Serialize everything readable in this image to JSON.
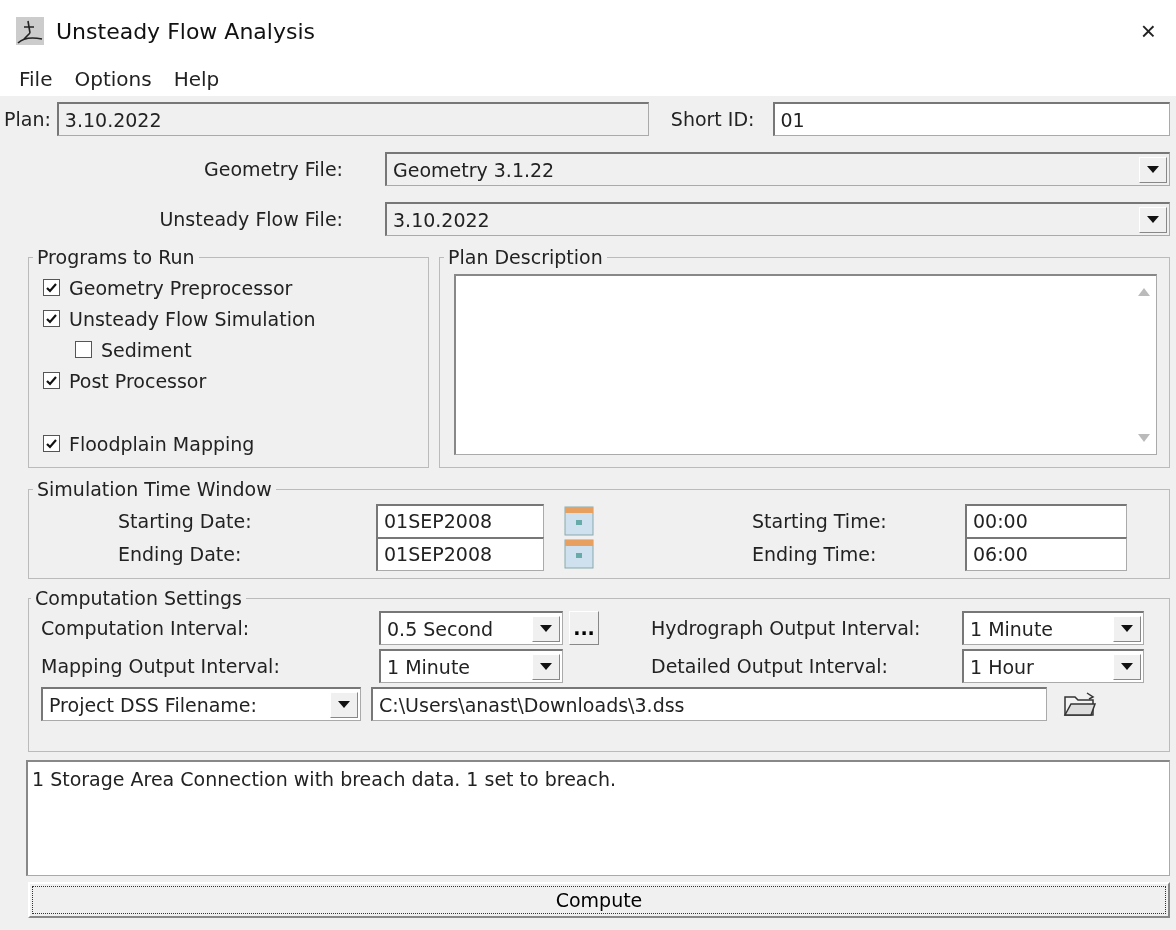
{
  "window": {
    "title": "Unsteady Flow Analysis",
    "close": "×"
  },
  "menu": [
    "File",
    "Options",
    "Help"
  ],
  "plan": {
    "label": "Plan:",
    "value": "3.10.2022"
  },
  "short_id": {
    "label": "Short ID:",
    "value": "01"
  },
  "file_selectors": [
    {
      "label": "Geometry File:",
      "value": "Geometry 3.1.22"
    },
    {
      "label": "Unsteady Flow File:",
      "value": "3.10.2022"
    }
  ],
  "programs_to_run": {
    "title": "Programs to Run",
    "items": [
      {
        "label": "Geometry Preprocessor",
        "checked": true
      },
      {
        "label": "Unsteady Flow Simulation",
        "checked": true,
        "children": [
          {
            "label": "Sediment",
            "checked": false
          }
        ]
      },
      {
        "label": "Post Processor",
        "checked": true
      },
      {
        "label": "Floodplain Mapping",
        "checked": true
      }
    ]
  },
  "plan_description": {
    "title": "Plan Description"
  },
  "simulation_time_window": {
    "title": "Simulation Time Window",
    "rows": [
      {
        "date_label": "Starting Date:",
        "date": "01SEP2008",
        "time_label": "Starting Time:",
        "time": "00:00"
      },
      {
        "date_label": "Ending Date:",
        "date": "01SEP2008",
        "time_label": "Ending Time:",
        "time": "06:00"
      }
    ]
  },
  "computation_settings": {
    "title": "Computation Settings",
    "more_button": "...",
    "intervals": [
      {
        "label": "Computation Interval:",
        "value": "0.5 Second"
      },
      {
        "label": "Hydrograph Output Interval:",
        "value": "1 Minute"
      },
      {
        "label": "Mapping Output Interval:",
        "value": "1 Minute"
      },
      {
        "label": "Detailed Output Interval:",
        "value": "1 Hour"
      }
    ],
    "dss": {
      "selector": "Project DSS Filename:",
      "path": "C:\\Users\\anast\\Downloads\\3.dss"
    }
  },
  "message": "1 Storage Area Connection with breach data. 1 set to breach.",
  "compute_button": "Compute"
}
